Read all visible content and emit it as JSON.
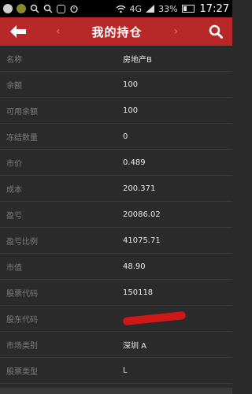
{
  "status_bar": {
    "network": "4G",
    "battery": "33%",
    "time": "17:27"
  },
  "header": {
    "title": "我的持仓",
    "back_icon": "back-arrow-icon",
    "search_icon": "search-icon",
    "prev_icon": "chevron-left-icon",
    "next_icon": "chevron-right-icon"
  },
  "rows": [
    {
      "label": "名称",
      "value": "房地产B"
    },
    {
      "label": "余额",
      "value": "100"
    },
    {
      "label": "可用余额",
      "value": "100"
    },
    {
      "label": "冻结数量",
      "value": "0"
    },
    {
      "label": "市价",
      "value": "0.489"
    },
    {
      "label": "成本",
      "value": " 200.371"
    },
    {
      "label": "盈亏",
      "value": "20086.02"
    },
    {
      "label": "盈亏比例",
      "value": "41075.71"
    },
    {
      "label": "市值",
      "value": "48.90"
    },
    {
      "label": "股票代码",
      "value": "150118"
    },
    {
      "label": "股东代码",
      "value": ""
    },
    {
      "label": "市场类别",
      "value": "深圳 A"
    },
    {
      "label": "股票类型",
      "value": "L"
    }
  ],
  "colors": {
    "header": "#b82828",
    "background": "#2b2b2b",
    "redaction": "#d11818"
  }
}
